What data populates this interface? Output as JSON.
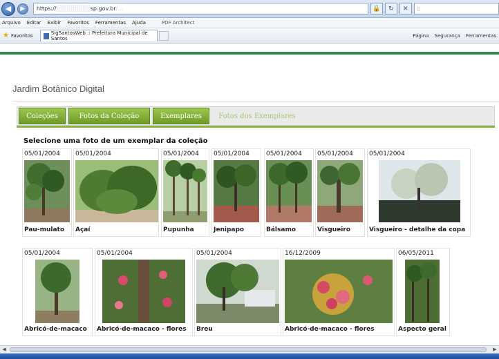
{
  "browser": {
    "address_text": "https://",
    "address_domain": "sp.gov.br",
    "address_path_hint": "/...",
    "menu_items": [
      "Arquivo",
      "Editar",
      "Exibir",
      "Favoritos",
      "Ferramentas",
      "Ajuda"
    ],
    "pdf_toolbar": "PDF Architect",
    "favorites_label": "Favoritos",
    "tab_title": "SigSantosWeb :: Prefeitura Municipal de Santos",
    "tools": [
      "Página",
      "Segurança",
      "Ferramentas"
    ]
  },
  "site": {
    "title": "Jardim Botânico Digital"
  },
  "tabs": [
    {
      "label": "Coleções",
      "active": true
    },
    {
      "label": "Fotos da Coleção",
      "active": true
    },
    {
      "label": "Exemplares",
      "active": true
    },
    {
      "label": "Fotos dos Exemplares",
      "active": false
    }
  ],
  "instruction": "Selecione uma foto de um exemplar da coleção",
  "photos": [
    {
      "date": "05/01/2004",
      "caption": "Pau-mulato"
    },
    {
      "date": "05/01/2004",
      "caption": "Açaí"
    },
    {
      "date": "05/01/2004",
      "caption": "Pupunha"
    },
    {
      "date": "05/01/2004",
      "caption": "Jenipapo"
    },
    {
      "date": "05/01/2004",
      "caption": "Bálsamo"
    },
    {
      "date": "05/01/2004",
      "caption": "Visgueiro"
    },
    {
      "date": "05/01/2004",
      "caption": "Visgueiro - detalhe da copa"
    },
    {
      "date": "05/01/2004",
      "caption": "Abricó-de-macaco"
    },
    {
      "date": "05/01/2004",
      "caption": "Abricó-de-macaco - flores"
    },
    {
      "date": "05/01/2004",
      "caption": "Breu"
    },
    {
      "date": "16/12/2009",
      "caption": "Abricó-de-macaco - flores"
    },
    {
      "date": "06/05/2011",
      "caption": "Aspecto geral"
    }
  ],
  "colors": {
    "tab_active": "#7ea634",
    "tab_inactive_text": "#a6c876",
    "header_line": "#2f8a48"
  }
}
